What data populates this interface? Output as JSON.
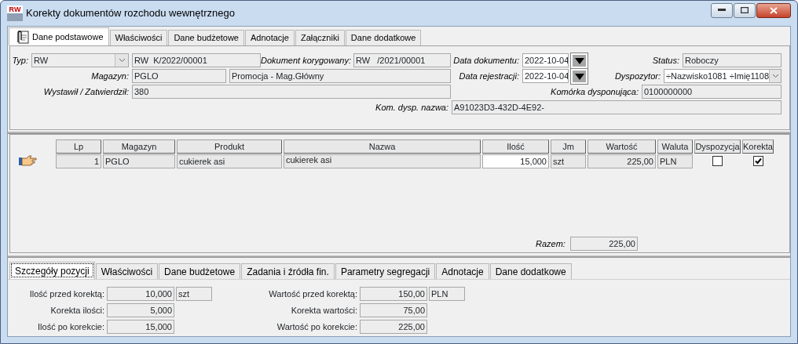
{
  "window": {
    "icon_text": "RW",
    "title": "Korekty dokumentów rozchodu wewnętrznego"
  },
  "tabs": [
    {
      "label": "Dane podstawowe",
      "selected": true
    },
    {
      "label": "Właściwości",
      "selected": false
    },
    {
      "label": "Dane budżetowe",
      "selected": false
    },
    {
      "label": "Adnotacje",
      "selected": false
    },
    {
      "label": "Załączniki",
      "selected": false
    },
    {
      "label": "Dane dodatkowe",
      "selected": false
    }
  ],
  "form_rows": [
    [
      {
        "label": "Typ:",
        "kind": "combo",
        "value": "RW"
      },
      {
        "kind": "field",
        "value": "RW  K/2022/00001"
      },
      {
        "label": "Dokument korygowany:",
        "kind": "field",
        "value": "RW   /2021/00001"
      },
      {
        "label": "Data dokumentu:",
        "kind": "date",
        "value": "2022-10-04"
      },
      {
        "label": "Status:",
        "kind": "field",
        "value": "Roboczy"
      }
    ],
    [
      {
        "label": "Magazyn:",
        "kind": "field",
        "value": "PGLO"
      },
      {
        "kind": "field",
        "value": "Promocja - Mag.Główny"
      },
      {
        "label": "Data rejestracji:",
        "kind": "date",
        "value": "2022-10-04"
      },
      {
        "label": "Dyspozytor:",
        "kind": "combo",
        "value": "÷Nazwisko1081 ÷Imię1108"
      }
    ],
    [
      {
        "label": "Wystawił / Zatwierdził:",
        "kind": "field",
        "value": "380"
      },
      {
        "label": "Komórka dysponująca:",
        "kind": "field",
        "value": "0100000000"
      }
    ],
    [
      {
        "label": "Kom. dysp. nazwa:",
        "kind": "field",
        "value": "A91023D3-432D-4E92-"
      }
    ]
  ],
  "grid": {
    "columns": [
      "Lp",
      "Magazyn",
      "Produkt",
      "Nazwa",
      "Ilość",
      "Jm",
      "Wartość",
      "Waluta",
      "Dyspozycja",
      "Korekta"
    ],
    "rows": [
      {
        "current": true,
        "lp": "1",
        "magazyn": "PGLO",
        "produkt": "cukierek asi",
        "nazwa": "cukierek asi",
        "ilosc": "15,000",
        "jm": "szt",
        "wartosc": "225,00",
        "waluta": "PLN",
        "dyspozycja": false,
        "korekta": true
      }
    ],
    "total_label": "Razem:",
    "total": "225,00"
  },
  "detail": {
    "tabs": [
      {
        "label": "Szczegóły pozycji",
        "selected": true
      },
      {
        "label": "Właściwości",
        "selected": false
      },
      {
        "label": "Dane budżetowe",
        "selected": false
      },
      {
        "label": "Zadania i źródła fin.",
        "selected": false
      },
      {
        "label": "Parametry segregacji",
        "selected": false
      },
      {
        "label": "Adnotacje",
        "selected": false
      },
      {
        "label": "Dane dodatkowe",
        "selected": false
      }
    ],
    "left": [
      {
        "label": "Ilość przed korektą:",
        "value": "10,000",
        "unit": "szt"
      },
      {
        "label": "Korekta ilości:",
        "value": "5,000"
      },
      {
        "label": "Ilość po korekcie:",
        "value": "15,000"
      }
    ],
    "right": [
      {
        "label": "Wartość przed korektą:",
        "value": "150,00",
        "unit": "PLN"
      },
      {
        "label": "Korekta wartości:",
        "value": "75,00"
      },
      {
        "label": "Wartość po korekcie:",
        "value": "225,00"
      }
    ]
  }
}
